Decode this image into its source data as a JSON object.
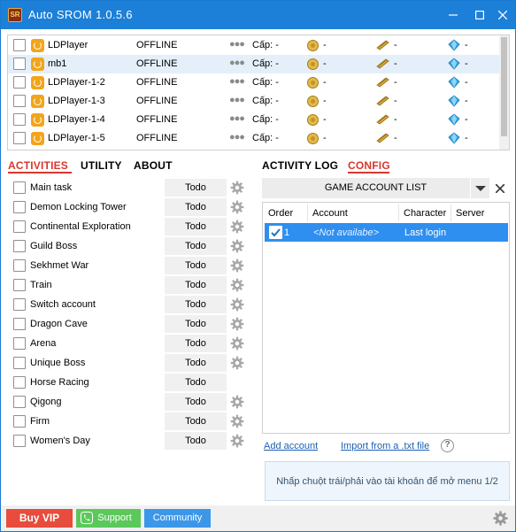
{
  "window": {
    "title": "Auto SROM 1.0.5.6",
    "controls": [
      "minimize-icon",
      "maximize-icon",
      "close-icon"
    ],
    "accent_color": "#1c7fd8"
  },
  "players": [
    {
      "name": "LDPlayer",
      "status": "OFFLINE",
      "level": "Cấp: -",
      "gold": "-",
      "item": "-",
      "gem": "-",
      "selected": false
    },
    {
      "name": "mb1",
      "status": "OFFLINE",
      "level": "Cấp: -",
      "gold": "-",
      "item": "-",
      "gem": "-",
      "selected": true
    },
    {
      "name": "LDPlayer-1-2",
      "status": "OFFLINE",
      "level": "Cấp: -",
      "gold": "-",
      "item": "-",
      "gem": "-",
      "selected": false
    },
    {
      "name": "LDPlayer-1-3",
      "status": "OFFLINE",
      "level": "Cấp: -",
      "gold": "-",
      "item": "-",
      "gem": "-",
      "selected": false
    },
    {
      "name": "LDPlayer-1-4",
      "status": "OFFLINE",
      "level": "Cấp: -",
      "gold": "-",
      "item": "-",
      "gem": "-",
      "selected": false
    },
    {
      "name": "LDPlayer-1-5",
      "status": "OFFLINE",
      "level": "Cấp: -",
      "gold": "-",
      "item": "-",
      "gem": "-",
      "selected": false
    }
  ],
  "left_tabs": {
    "activities": "ACTIVITIES",
    "utility": "UTILITY",
    "about": "ABOUT",
    "active": "activities"
  },
  "activities": [
    {
      "label": "Main task",
      "button": "Todo",
      "has_settings": true
    },
    {
      "label": "Demon Locking Tower",
      "button": "Todo",
      "has_settings": true
    },
    {
      "label": "Continental Exploration",
      "button": "Todo",
      "has_settings": true
    },
    {
      "label": "Guild Boss",
      "button": "Todo",
      "has_settings": true
    },
    {
      "label": "Sekhmet War",
      "button": "Todo",
      "has_settings": true
    },
    {
      "label": "Train",
      "button": "Todo",
      "has_settings": true
    },
    {
      "label": "Switch account",
      "button": "Todo",
      "has_settings": true
    },
    {
      "label": "Dragon Cave",
      "button": "Todo",
      "has_settings": true
    },
    {
      "label": "Arena",
      "button": "Todo",
      "has_settings": true
    },
    {
      "label": "Unique Boss",
      "button": "Todo",
      "has_settings": true
    },
    {
      "label": "Horse Racing",
      "button": "Todo",
      "has_settings": false
    },
    {
      "label": "Qigong",
      "button": "Todo",
      "has_settings": true
    },
    {
      "label": "Firm",
      "button": "Todo",
      "has_settings": true
    },
    {
      "label": "Women's Day",
      "button": "Todo",
      "has_settings": true
    }
  ],
  "right_tabs": {
    "activity_log": "ACTIVITY LOG",
    "config": "CONFIG",
    "active": "config"
  },
  "config": {
    "list_title": "GAME ACCOUNT LIST",
    "columns": {
      "order": "Order",
      "account": "Account",
      "character": "Character",
      "server": "Server"
    },
    "rows": [
      {
        "checked": true,
        "order": "1",
        "account": "<Not availabe>",
        "character": "Last login",
        "server": ""
      }
    ],
    "add_account": "Add account",
    "import_file": "Import from a .txt file",
    "help_symbol": "?",
    "hint": "Nhấp chuột trái/phải vào tài khoản để mở menu 1/2"
  },
  "footer": {
    "buy_vip": "Buy VIP",
    "support": "Support",
    "community": "Community",
    "colors": {
      "buy_vip": "#e74c3c",
      "support": "#5bc85b",
      "community": "#3d97e8"
    }
  }
}
